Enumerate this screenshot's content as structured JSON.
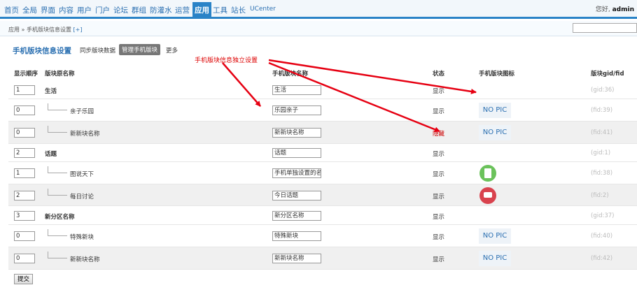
{
  "nav": {
    "items": [
      "首页",
      "全局",
      "界面",
      "内容",
      "用户",
      "门户",
      "论坛",
      "群组",
      "防灌水",
      "运营",
      "应用",
      "工具",
      "站长",
      "UCenter"
    ],
    "active": "应用",
    "greeting_prefix": "您好,",
    "greeting_user": "admin"
  },
  "breadcrumb": {
    "text": "应用 » 手机版块信息设置",
    "plus": "[+]"
  },
  "page": {
    "title": "手机版块信息设置",
    "tabs": [
      "同步版块数据",
      "管理手机版块",
      "更多"
    ],
    "active_tab": "管理手机版块"
  },
  "annotation": "手机版块信息独立设置",
  "table": {
    "headers": [
      "显示顺序",
      "版块原名称",
      "手机版块名称",
      "状态",
      "手机版块图标",
      "版块gid/fid"
    ],
    "rows": [
      {
        "order": "1",
        "name": "生活",
        "mobile_name": "生活",
        "status": "显示",
        "icon": "",
        "id": "(gid:36)",
        "level": 0,
        "shade": false
      },
      {
        "order": "0",
        "name": "亲子乐园",
        "mobile_name": "乐园亲子",
        "status": "显示",
        "icon": "NO PIC",
        "id": "(fid:39)",
        "level": 1,
        "shade": false
      },
      {
        "order": "0",
        "name": "新新块名称",
        "mobile_name": "新新块名称",
        "status": "隐藏",
        "icon": "NO PIC",
        "id": "(fid:41)",
        "level": 1,
        "shade": true
      },
      {
        "order": "2",
        "name": "话题",
        "mobile_name": "话题",
        "status": "显示",
        "icon": "",
        "id": "(gid:1)",
        "level": 0,
        "shade": false
      },
      {
        "order": "1",
        "name": "图说天下",
        "mobile_name": "手机单独设置的名称",
        "status": "显示",
        "icon": "green",
        "id": "(fid:38)",
        "level": 1,
        "shade": false
      },
      {
        "order": "2",
        "name": "每日讨论",
        "mobile_name": "今日话题",
        "status": "显示",
        "icon": "red",
        "id": "(fid:2)",
        "level": 1,
        "shade": true
      },
      {
        "order": "3",
        "name": "新分区名称",
        "mobile_name": "新分区名称",
        "status": "显示",
        "icon": "",
        "id": "(gid:37)",
        "level": 0,
        "shade": false
      },
      {
        "order": "0",
        "name": "特殊新块",
        "mobile_name": "特殊新块",
        "status": "显示",
        "icon": "NO PIC",
        "id": "(fid:40)",
        "level": 1,
        "shade": false
      },
      {
        "order": "0",
        "name": "新新块名称",
        "mobile_name": "新新块名称",
        "status": "显示",
        "icon": "NO PIC",
        "id": "(fid:42)",
        "level": 1,
        "shade": true
      }
    ]
  },
  "submit_label": "提交",
  "colors": {
    "accent": "#2a83c7",
    "link": "#2a6fb1",
    "arrow": "#e60012",
    "hidden_status": "#cc0000"
  }
}
